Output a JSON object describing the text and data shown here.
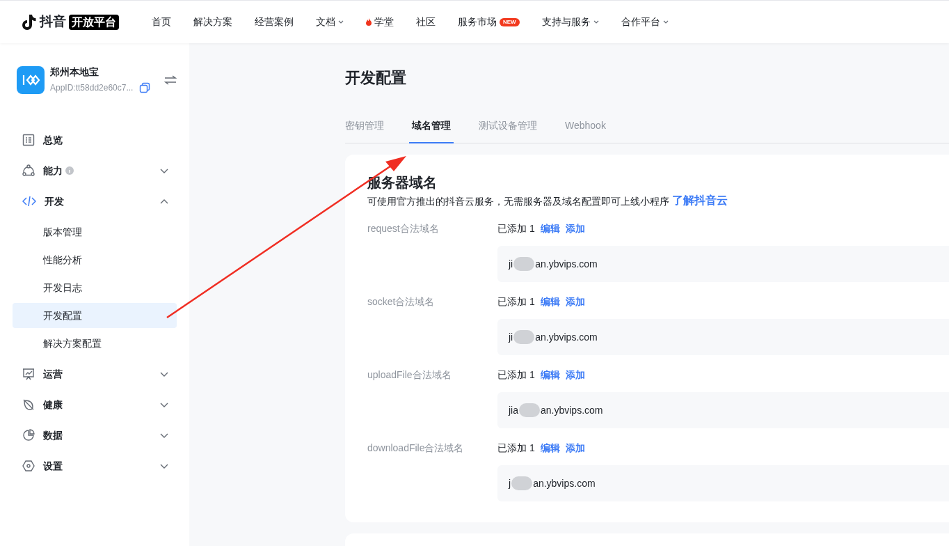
{
  "brand": {
    "name": "抖音",
    "tag": "开放平台"
  },
  "nav": [
    {
      "label": "首页",
      "kind": "plain"
    },
    {
      "label": "解决方案",
      "kind": "plain"
    },
    {
      "label": "经营案例",
      "kind": "plain"
    },
    {
      "label": "文档",
      "kind": "dropdown"
    },
    {
      "label": "学堂",
      "kind": "hot"
    },
    {
      "label": "社区",
      "kind": "plain"
    },
    {
      "label": "服务市场",
      "kind": "badge",
      "badge": "NEW"
    },
    {
      "label": "支持与服务",
      "kind": "dropdown"
    },
    {
      "label": "合作平台",
      "kind": "dropdown"
    }
  ],
  "app": {
    "name": "郑州本地宝",
    "appid": "AppID:tt58dd2e60c7..."
  },
  "sidebar": {
    "items": [
      {
        "label": "总览",
        "kind": "plain"
      },
      {
        "label": "能力",
        "kind": "group",
        "info": true,
        "expanded": false
      },
      {
        "label": "开发",
        "kind": "group",
        "info": false,
        "expanded": true,
        "children": [
          {
            "label": "版本管理",
            "selected": false
          },
          {
            "label": "性能分析",
            "selected": false
          },
          {
            "label": "开发日志",
            "selected": false
          },
          {
            "label": "开发配置",
            "selected": true
          },
          {
            "label": "解决方案配置",
            "selected": false
          }
        ]
      },
      {
        "label": "运营",
        "kind": "group",
        "info": false,
        "expanded": false
      },
      {
        "label": "健康",
        "kind": "group",
        "info": false,
        "expanded": false
      },
      {
        "label": "数据",
        "kind": "group",
        "info": false,
        "expanded": false
      },
      {
        "label": "设置",
        "kind": "group",
        "info": false,
        "expanded": false
      }
    ]
  },
  "page_title": "开发配置",
  "tabs": [
    {
      "label": "密钥管理",
      "selected": false
    },
    {
      "label": "域名管理",
      "selected": true
    },
    {
      "label": "测试设备管理",
      "selected": false
    },
    {
      "label": "Webhook",
      "selected": false
    }
  ],
  "section": {
    "title": "服务器域名",
    "note": "可使用官方推出的抖音云服务，无需服务器及域名配置即可上线小程序",
    "link": "了解抖音云",
    "rows": [
      {
        "label": "request合法域名",
        "count": "已添加 1",
        "actions": [
          "编辑",
          "添加"
        ],
        "domain_start": "ji",
        "domain_end": "an.ybvips.com"
      },
      {
        "label": "socket合法域名",
        "count": "已添加 1",
        "actions": [
          "编辑",
          "添加"
        ],
        "domain_start": "ji",
        "domain_end": "an.ybvips.com"
      },
      {
        "label": "uploadFile合法域名",
        "count": "已添加 1",
        "actions": [
          "编辑",
          "添加"
        ],
        "domain_start": "jia",
        "domain_end": "an.ybvips.com"
      },
      {
        "label": "downloadFile合法域名",
        "count": "已添加 1",
        "actions": [
          "编辑",
          "添加"
        ],
        "domain_start": "j",
        "domain_end": "an.ybvips.com"
      }
    ]
  }
}
